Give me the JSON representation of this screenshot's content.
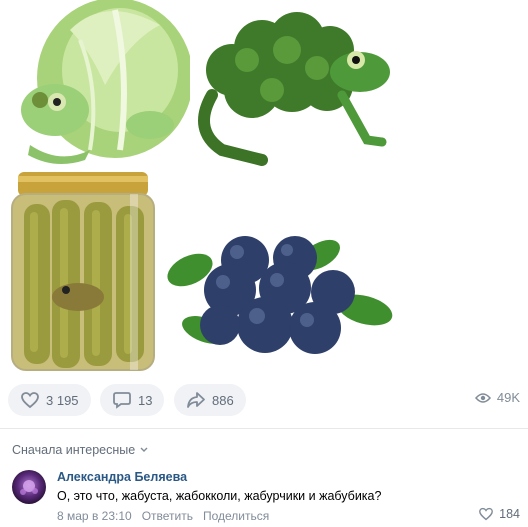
{
  "post": {
    "images": [
      {
        "icon": "cabbage-frog-image"
      },
      {
        "icon": "broccoli-frog-image"
      },
      {
        "icon": "pickle-jar-frog-image"
      },
      {
        "icon": "blueberry-frogs-image"
      }
    ],
    "actions": {
      "likes": "3 195",
      "comments": "13",
      "shares": "886",
      "views": "49K"
    }
  },
  "comments_section": {
    "sort_label": "Сначала интересные",
    "items": [
      {
        "author": "Александра Беляева",
        "text": "О, это что, жабуста, жабокколи, жабурчики и жабубика?",
        "date": "8 мар в 23:10",
        "reply_label": "Ответить",
        "share_label": "Поделиться",
        "likes": "184"
      }
    ]
  },
  "colors": {
    "link": "#2a5885",
    "secondary_text": "#818c99",
    "pill_bg": "#f0f2f5",
    "divider": "#e7e8ec"
  }
}
